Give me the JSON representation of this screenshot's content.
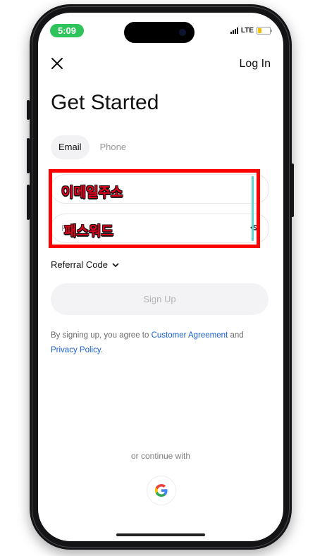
{
  "status_bar": {
    "time": "5:09",
    "network": "LTE"
  },
  "header": {
    "close_icon": "close-icon",
    "login_label": "Log In"
  },
  "title": "Get Started",
  "tabs": [
    {
      "label": "Email",
      "active": true
    },
    {
      "label": "Phone",
      "active": false
    }
  ],
  "form": {
    "email_placeholder": "",
    "password_placeholder": "P",
    "password_toggle_icon": "eye-off-icon"
  },
  "annotations": {
    "email_overlay": "이메일주소",
    "password_overlay": "패스워드",
    "highlight_color": "#ff0000"
  },
  "referral": {
    "label": "Referral Code",
    "chevron_icon": "chevron-down-icon"
  },
  "signup_label": "Sign Up",
  "terms": {
    "prefix": "By signing up, you agree to ",
    "agreement_link": "Customer Agreement",
    "middle": " and",
    "privacy_link": "Privacy Policy",
    "suffix": "."
  },
  "continue_with": "or continue with",
  "social": {
    "google_icon": "google-icon"
  },
  "colors": {
    "link": "#1a5fd1",
    "time_pill": "#2fc35b"
  }
}
